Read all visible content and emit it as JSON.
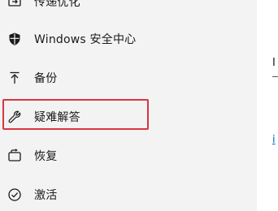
{
  "sidebar": {
    "items": [
      {
        "label": "传递优化",
        "icon": "delivery-optimization-icon"
      },
      {
        "label": "Windows 安全中心",
        "icon": "shield-icon"
      },
      {
        "label": "备份",
        "icon": "backup-arrow-icon"
      },
      {
        "label": "疑难解答",
        "icon": "wrench-icon"
      },
      {
        "label": "恢复",
        "icon": "recovery-icon"
      },
      {
        "label": "激活",
        "icon": "activation-check-icon"
      }
    ]
  },
  "content": {
    "partial_text": "I",
    "partial_link": "i"
  },
  "colors": {
    "sidebar_bg": "#f3f3f3",
    "content_bg": "#ffffff",
    "highlight_border": "#d9363e",
    "text": "#1a1a1a",
    "link": "#0067c0"
  }
}
